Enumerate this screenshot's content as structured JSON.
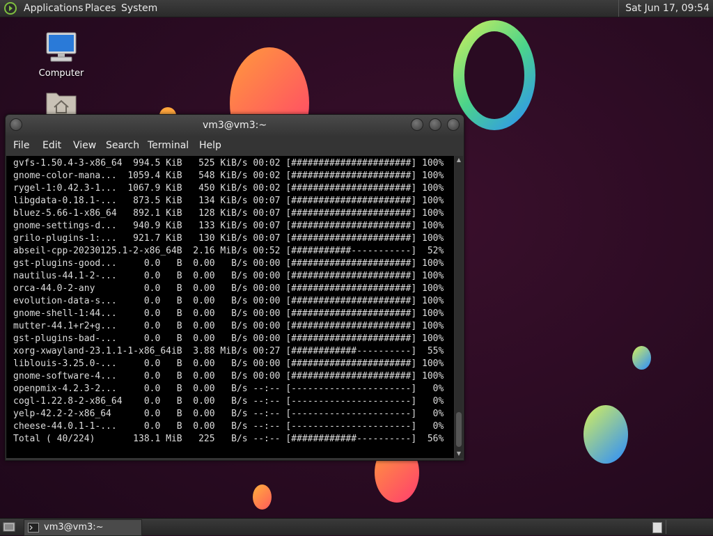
{
  "top_panel": {
    "menus": [
      "Applications",
      "Places",
      "System"
    ],
    "clock": "Sat Jun 17, 09:54"
  },
  "desktop": {
    "icons": [
      {
        "label": "Computer",
        "icon": "computer-icon"
      },
      {
        "label": "",
        "icon": "home-folder-icon"
      }
    ]
  },
  "terminal": {
    "title": "vm3@vm3:~",
    "menu": [
      "File",
      "Edit",
      "View",
      "Search",
      "Terminal",
      "Help"
    ],
    "lines": [
      "gvfs-1.50.4-3-x86_64  994.5 KiB   525 KiB/s 00:02 [######################] 100%",
      "gnome-color-mana...  1059.4 KiB   548 KiB/s 00:02 [######################] 100%",
      "rygel-1:0.42.3-1...  1067.9 KiB   450 KiB/s 00:02 [######################] 100%",
      "libgdata-0.18.1-...   873.5 KiB   134 KiB/s 00:07 [######################] 100%",
      "bluez-5.66-1-x86_64   892.1 KiB   128 KiB/s 00:07 [######################] 100%",
      "gnome-settings-d...   940.9 KiB   133 KiB/s 00:07 [######################] 100%",
      "grilo-plugins-1:...   921.7 KiB   130 KiB/s 00:07 [######################] 100%",
      "abseil-cpp-20230125.1-2-x86_64B  2.16 MiB/s 00:52 [###########-----------]  52%",
      "gst-plugins-good...     0.0   B  0.00   B/s 00:00 [######################] 100%",
      "nautilus-44.1-2-...     0.0   B  0.00   B/s 00:00 [######################] 100%",
      "orca-44.0-2-any         0.0   B  0.00   B/s 00:00 [######################] 100%",
      "evolution-data-s...     0.0   B  0.00   B/s 00:00 [######################] 100%",
      "gnome-shell-1:44...     0.0   B  0.00   B/s 00:00 [######################] 100%",
      "mutter-44.1+r2+g...     0.0   B  0.00   B/s 00:00 [######################] 100%",
      "gst-plugins-bad-...     0.0   B  0.00   B/s 00:00 [######################] 100%",
      "xorg-xwayland-23.1.1-1-x86_64iB  3.88 MiB/s 00:27 [############----------]  55%",
      "liblouis-3.25.0-...     0.0   B  0.00   B/s 00:00 [######################] 100%",
      "gnome-software-4...     0.0   B  0.00   B/s 00:00 [######################] 100%",
      "openpmix-4.2.3-2...     0.0   B  0.00   B/s --:-- [----------------------]   0%",
      "cogl-1.22.8-2-x86_64    0.0   B  0.00   B/s --:-- [----------------------]   0%",
      "yelp-42.2-2-x86_64      0.0   B  0.00   B/s --:-- [----------------------]   0%",
      "cheese-44.0.1-1-...     0.0   B  0.00   B/s --:-- [----------------------]   0%",
      "Total ( 40/224)       138.1 MiB   225   B/s --:-- [############----------]  56%"
    ]
  },
  "taskbar": {
    "task_label": "vm3@vm3:~"
  }
}
